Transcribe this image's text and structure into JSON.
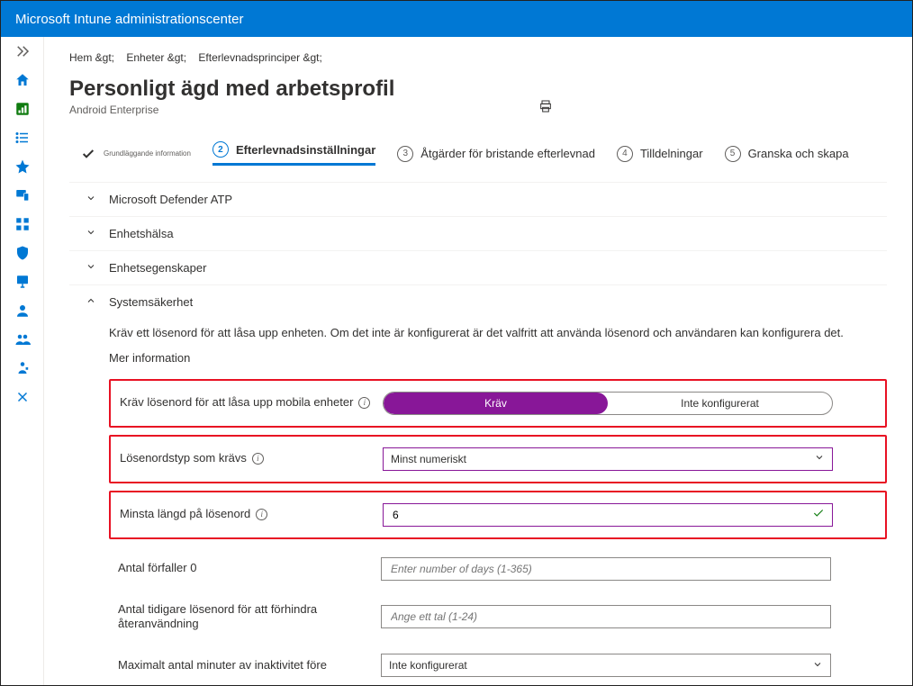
{
  "header": {
    "title": "Microsoft Intune administrationscenter"
  },
  "breadcrumb": [
    "Hem &gt;",
    "Enheter &gt;",
    "Efterlevnadsprinciper &gt;"
  ],
  "page": {
    "title": "Personligt ägd med arbetsprofil",
    "subtitle": "Android Enterprise"
  },
  "steps": {
    "s1": "Grundläggande information",
    "s2": "Efterlevnadsinställningar",
    "s3": "Åtgärder för bristande efterlevnad",
    "s4": "Tilldelningar",
    "s5": "Granska och skapa"
  },
  "sections": {
    "defender": "Microsoft Defender ATP",
    "health": "Enhetshälsa",
    "props": "Enhetsegenskaper",
    "security": "Systemsäkerhet"
  },
  "security": {
    "desc": "Kräv ett lösenord för att låsa upp enheten. Om det inte är konfigurerat är det valfritt att använda lösenord och användaren kan konfigurera det.",
    "moreinfo": "Mer information",
    "row1": {
      "label": "Kräv lösenord för att låsa upp mobila enheter",
      "opt1": "Kräv",
      "opt2": "Inte konfigurerat"
    },
    "row2": {
      "label": "Lösenordstyp som krävs",
      "value": "Minst numeriskt"
    },
    "row3": {
      "label": "Minsta längd på lösenord",
      "value": "6"
    },
    "row4": {
      "label": "Antal förfaller 0",
      "placeholder": "Enter number of days (1-365)"
    },
    "row5": {
      "label": "Antal tidigare lösenord för att förhindra återanvändning",
      "placeholder": "Ange ett tal (1-24)"
    },
    "row6": {
      "label": "Maximalt antal minuter av inaktivitet före",
      "value": "Inte konfigurerat"
    }
  }
}
